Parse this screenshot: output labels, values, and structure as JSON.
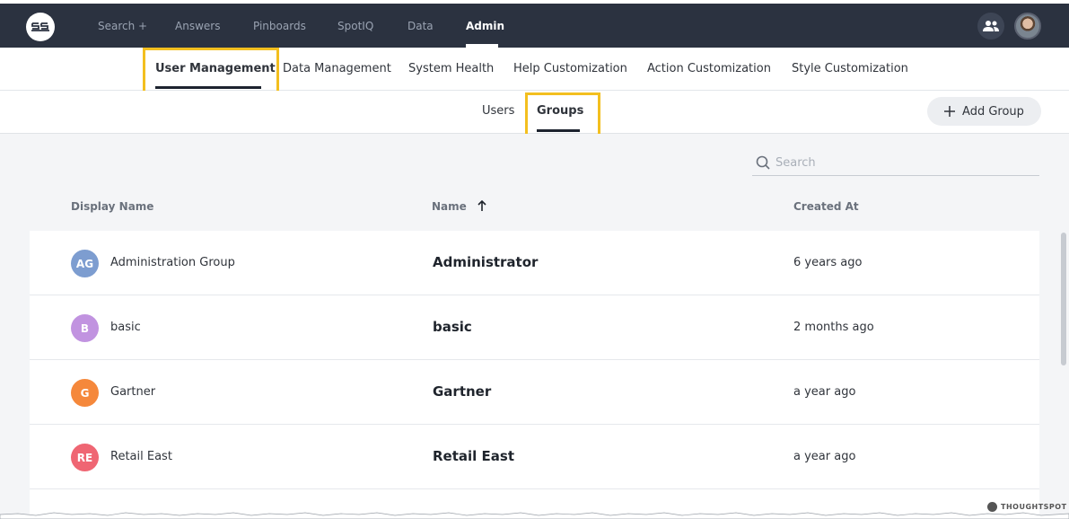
{
  "nav": {
    "items": [
      {
        "label": "Search +"
      },
      {
        "label": "Answers"
      },
      {
        "label": "Pinboards"
      },
      {
        "label": "SpotIQ"
      },
      {
        "label": "Data"
      },
      {
        "label": "Admin",
        "active": true
      }
    ]
  },
  "admin_tabs": [
    {
      "label": "User Management",
      "active": true
    },
    {
      "label": "Data Management"
    },
    {
      "label": "System Health"
    },
    {
      "label": "Help Customization"
    },
    {
      "label": "Action Customization"
    },
    {
      "label": "Style Customization"
    }
  ],
  "sub_tabs": [
    {
      "label": "Users"
    },
    {
      "label": "Groups",
      "active": true
    }
  ],
  "add_group_label": "Add Group",
  "search": {
    "placeholder": "Search"
  },
  "columns": {
    "display_name": "Display Name",
    "name": "Name",
    "created_at": "Created At"
  },
  "rows": [
    {
      "initials": "AG",
      "display_name": "Administration Group",
      "name": "Administrator",
      "created": "6 years ago",
      "color": "#7d9dd0"
    },
    {
      "initials": "B",
      "display_name": "basic",
      "name": "basic",
      "created": "2 months ago",
      "color": "#c193e0"
    },
    {
      "initials": "G",
      "display_name": "Gartner",
      "name": "Gartner",
      "created": "a year ago",
      "color": "#f5883b"
    },
    {
      "initials": "RE",
      "display_name": "Retail East",
      "name": "Retail East",
      "created": "a year ago",
      "color": "#ef6673"
    }
  ],
  "brand": "THOUGHTSPOT",
  "colors": {
    "nav_bg": "#2b3240",
    "highlight": "#f3bf1f"
  }
}
